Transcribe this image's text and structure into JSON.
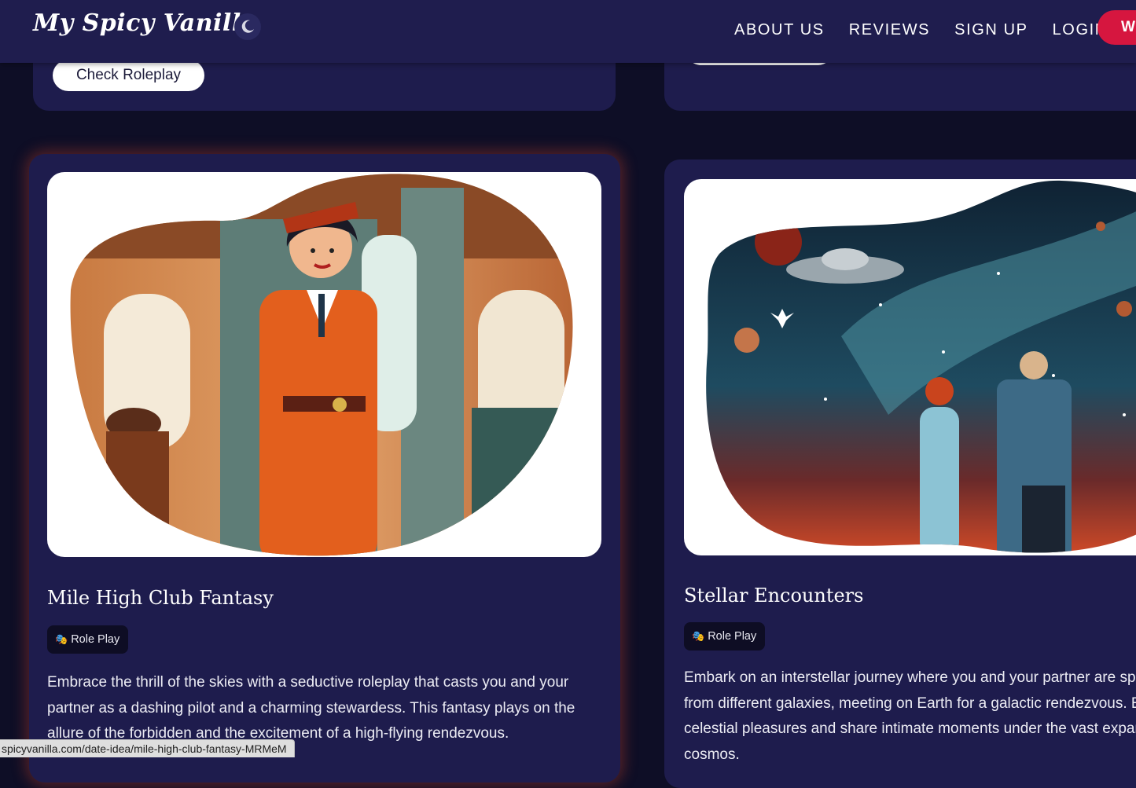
{
  "brand": {
    "logo_text": "My Spicy Vanilla",
    "theme_toggle_icon": "moon-icon"
  },
  "nav": {
    "items": [
      "ABOUT US",
      "REVIEWS",
      "SIGN UP",
      "LOGIN"
    ],
    "cta_label": "W"
  },
  "top_cards": {
    "left_button_label": "Check Roleplay"
  },
  "cards": [
    {
      "title": "Mile High Club Fantasy",
      "tag": "Role Play",
      "tag_icon": "theater-masks-icon",
      "description_lines": [
        "Embrace the thrill of the skies with a seductive roleplay that casts you and your",
        "partner as a dashing pilot and a charming stewardess. This fantasy plays on the",
        "allure of the forbidden and the excitement of a high-flying rendezvous."
      ],
      "image_icon": "stewardess-illustration"
    },
    {
      "title": "Stellar Encounters",
      "tag": "Role Play",
      "tag_icon": "theater-masks-icon",
      "description_lines": [
        "Embark on an interstellar journey where you and your partner are spa",
        "from different galaxies, meeting on Earth for a galactic rendezvous. En",
        "celestial pleasures and share intimate moments under the vast expans",
        "cosmos."
      ],
      "image_icon": "space-couple-illustration"
    }
  ],
  "status_bar": {
    "url": "spicyvanilla.com/date-idea/mile-high-club-fantasy-MRMeM"
  },
  "colors": {
    "header_bg": "#1f1d4e",
    "card_bg": "#1e1c4d",
    "page_bg": "#0e0e26",
    "cta": "#d6163f"
  }
}
